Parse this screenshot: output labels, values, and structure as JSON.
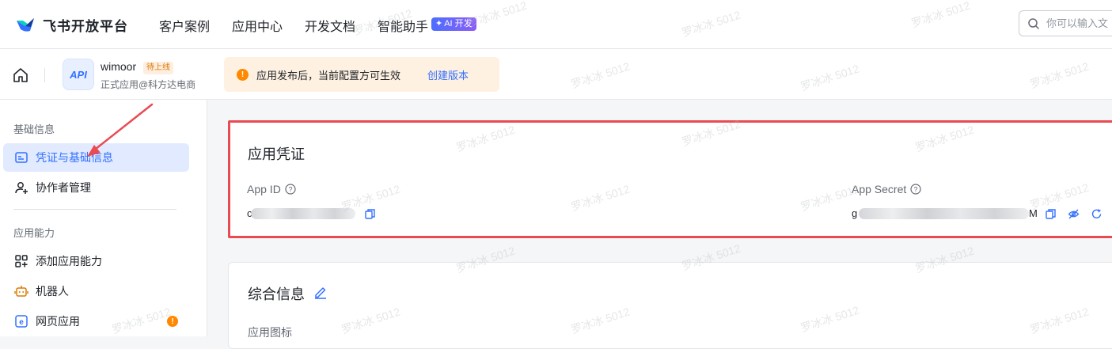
{
  "header": {
    "brand": "飞书开放平台",
    "nav": [
      "客户案例",
      "应用中心",
      "开发文档",
      "智能助手"
    ],
    "ai_badge": "AI 开发",
    "search_placeholder": "你可以输入文"
  },
  "app": {
    "avatar_text": "API",
    "name": "wimoor",
    "status": "待上线",
    "subtitle": "正式应用@科方达电商",
    "notice_text": "应用发布后，当前配置方可生效",
    "notice_link": "创建版本"
  },
  "sidebar": {
    "group1": "基础信息",
    "item_credentials": "凭证与基础信息",
    "item_collaborators": "协作者管理",
    "group2": "应用能力",
    "item_add_capability": "添加应用能力",
    "item_bot": "机器人",
    "item_web_app": "网页应用",
    "web_app_alert": "!"
  },
  "credentials": {
    "title": "应用凭证",
    "app_id_label": "App ID",
    "app_id_visible_prefix": "c",
    "app_secret_label": "App Secret",
    "app_secret_visible_prefix": "g",
    "app_secret_visible_suffix": "M"
  },
  "general": {
    "title": "综合信息",
    "icon_label": "应用图标"
  },
  "watermark": "罗冰冰 5012",
  "colors": {
    "accent": "#3370ff",
    "highlight_border": "#ea4a52",
    "notice_bg": "#fef1e1",
    "status_orange": "#de7802"
  }
}
